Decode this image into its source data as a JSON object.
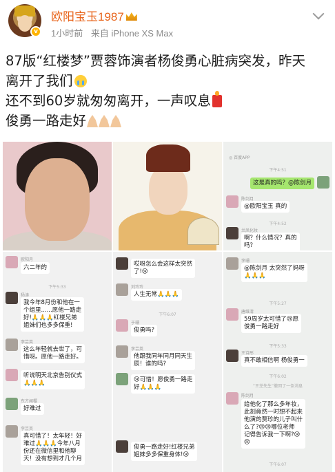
{
  "post": {
    "username": "欧阳宝玉1987",
    "time": "1小时前",
    "source": "来自 iPhone XS Max",
    "lines": [
      "87版“红楼梦”贾蓉饰演者杨俊勇心脏病突发，昨天",
      "离开了我们",
      "还不到60岁就匆匆离开，一声叹息",
      "俊勇一路走好"
    ]
  },
  "icons": {
    "avatar": "user-avatar",
    "verified": "verified-badge-icon",
    "crown": "crown-icon",
    "more": "chevron-down-icon",
    "cry": "crying-face-emoji",
    "candle": "candle-emoji",
    "pray": "praying-hands-emoji"
  },
  "colors": {
    "username": "#e8641b",
    "meta": "#8a8a8a",
    "bubble_green": "#a5e66e"
  },
  "grid": {
    "c3": {
      "app": "◎ 百度APP",
      "t1": "下午4:51",
      "msg1": "这是真的吗？@陈剑月",
      "nick2": "陈剑月",
      "msg2": "@欧阳宝玉 真的",
      "t2": "下午4:52",
      "nick3": "兰凤化妆",
      "msg3a": "啊？什么情况？真的",
      "msg3b": "吗？"
    },
    "c4": {
      "nick1": "欧阳月",
      "msg1": "六二年的",
      "t1": "下午5:33",
      "nick2": "杨涛",
      "msg2a": "我今年8月份和他在一",
      "msg2b": "个组里......愿他一路走",
      "msg2c": "好!🙏🙏🙏红楼兄弟",
      "msg2d": "姐妹们也多多保重!",
      "nick3": "李芸英",
      "msg3a": "这么年轻就去世了，可",
      "msg3b": "惜呀。愿他一路走好。",
      "msg4": "听说明天北京告别仪式",
      "msg4b": "🙏🙏🙏",
      "nick5": "东方闻樱",
      "msg5": "好难过",
      "nick6": "李芸英",
      "msg6a": "真可惜了！太年轻！好",
      "msg6b": "难过🙏🙏🙏今年八月",
      "msg6c": "份还在微信里和他聊",
      "msg6d": "天！没有想到才几个月"
    },
    "c5": {
      "msg1a": "哎呀怎么会这样太突然",
      "msg1b": "了!😢",
      "nick2": "刘玲玲",
      "msg2": "人生无常🙏🙏🙏",
      "t2": "下午6:07",
      "nick3": "于珊",
      "msg3": "俊勇吗?",
      "nick4": "李芸英",
      "msg4a": "他跟我同年同月同天生",
      "msg4b": "辰！谁的吗?",
      "msg5a": "😢可惜！愿俊勇一路走",
      "msg5b": "好🙏🙏🙏",
      "msg6a": "俊勇一路走好!红楼兄弟",
      "msg6b": "姐妹多多保重身体!😢"
    },
    "c6": {
      "nick1": "李珊",
      "msg1a": "@陈剑月 太突然了妈呀",
      "msg1b": "🙏🙏🙏",
      "t1": "下午5:27",
      "nick2": "唐维清",
      "msg2a": "59周岁太可惜了😢愿",
      "msg2b": "俊勇一路走好",
      "t2": "下午5:33",
      "nick3": "王诗彤",
      "msg3": "真不敢相信啊 杨俊勇一",
      "t3": "下午6:02",
      "notice": "“王芝先生”撤回了一条消息",
      "nick4": "陈剑月",
      "msg4a": "给他化了那么多年妆，",
      "msg4b": "此刻竟然一时想不起来",
      "msg4c": "他演的贾珍的儿子叫什",
      "msg4d": "么了?😢😢哪位老师",
      "msg4e": "记得告诉我一下啊?😢",
      "msg4f": "😢",
      "t4": "下午6:07"
    }
  }
}
